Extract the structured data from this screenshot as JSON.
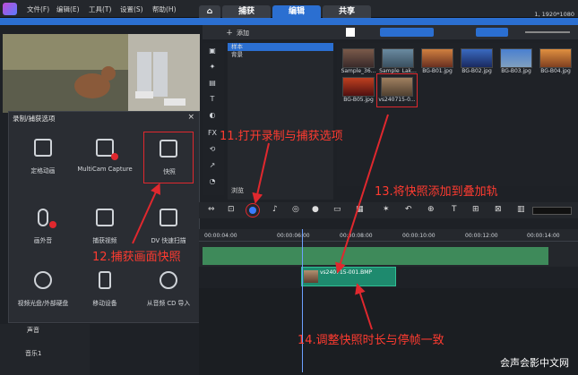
{
  "topbar": {
    "menus": [
      "文件(F)",
      "编辑(E)",
      "工具(T)",
      "设置(S)",
      "帮助(H)"
    ],
    "tabs": {
      "capture": "捕获",
      "edit": "编辑",
      "share": "共享"
    },
    "resolution": "1, 1920*1080"
  },
  "capture_panel": {
    "title": "录制/捕获选项",
    "close": "×",
    "items": [
      "定格动画",
      "MultiCam Capture",
      "快照",
      "画外音",
      "捕获视频",
      "DV 快速扫描",
      "视频光盘/外部硬盘",
      "移动设备",
      "从音频 CD 导入"
    ]
  },
  "library": {
    "add_label": "添加",
    "folders": [
      "样本",
      "背景"
    ],
    "thumbnails": [
      "Sample_36...",
      "Sample_Lak...",
      "BG-B01.jpg",
      "BG-B02.jpg",
      "BG-B03.jpg",
      "BG-B04.jpg",
      "BG-B05.jpg",
      "vs240715-0..."
    ],
    "browse_label": "浏览"
  },
  "timeline": {
    "ticks": [
      "00:00:04:00",
      "00:00:06:00",
      "00:00:08:00",
      "00:00:10:00",
      "00:00:12:00",
      "00:00:14:00"
    ],
    "overlay_clip": "vs240715-001.BMP",
    "tracks": [
      "声音",
      "音乐1"
    ]
  },
  "annotations": {
    "a11": "11.打开录制与捕获选项",
    "a12": "12.捕获画面快照",
    "a13": "13.将快照添加到叠加轨",
    "a14": "14.调整快照时长与停帧一致"
  },
  "watermark": "会声会影中文网",
  "colors": {
    "accent": "#2b6fd1",
    "annotation": "#ff3b30",
    "clip": "#1e8a6e",
    "track": "#3e8a5a"
  }
}
